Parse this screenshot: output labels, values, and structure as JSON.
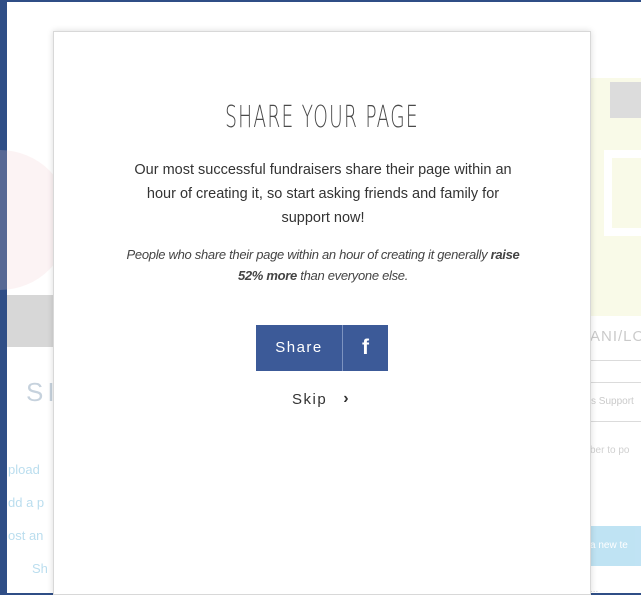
{
  "background": {
    "left_heading": "SI",
    "left_links": [
      "pload",
      "dd a p",
      "ost an",
      "Sh"
    ],
    "right_caps": "ANI/LO",
    "right_input_text": "s Support",
    "right_small_text": "ber to po",
    "right_button_text": "a new te",
    "right_bottom_text": "..."
  },
  "modal": {
    "title": "SHARE YOUR PAGE",
    "body": "Our most successful fundraisers share their page within an hour of creating it, so start asking friends and family for support now!",
    "note_prefix": "People who share their page within an hour of creating it generally ",
    "note_bold": "raise 52% more",
    "note_suffix": " than everyone else.",
    "share_label": "Share",
    "facebook_icon": "f",
    "skip_label": "Skip",
    "skip_icon": "›"
  },
  "colors": {
    "facebook_blue": "#3c5a98",
    "frame_blue": "#2f4e86"
  }
}
